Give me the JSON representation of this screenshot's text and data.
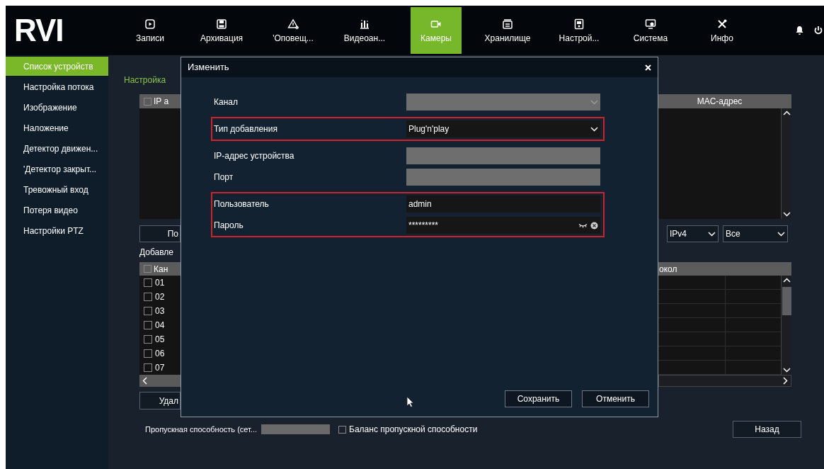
{
  "logo": "RVI",
  "nav": [
    {
      "label": "Записи",
      "selected": false
    },
    {
      "label": "Архивация",
      "selected": false
    },
    {
      "label": "'Оповещ...",
      "selected": false
    },
    {
      "label": "Видеоан...",
      "selected": false
    },
    {
      "label": "Камеры",
      "selected": true
    },
    {
      "label": "Хранилище",
      "selected": false
    },
    {
      "label": "Настрой...",
      "selected": false
    },
    {
      "label": "Система",
      "selected": false
    },
    {
      "label": "Инфо",
      "selected": false
    }
  ],
  "sidebar": {
    "items": [
      {
        "label": "Список устройств",
        "selected": true
      },
      {
        "label": "Настройка потока",
        "selected": false
      },
      {
        "label": "Изображение",
        "selected": false
      },
      {
        "label": "Наложение",
        "selected": false
      },
      {
        "label": "Детектор движен...",
        "selected": false
      },
      {
        "label": "'Детектор закрыт...",
        "selected": false
      },
      {
        "label": "Тревожный вход",
        "selected": false
      },
      {
        "label": "Потеря видео",
        "selected": false
      },
      {
        "label": "Настройки PTZ",
        "selected": false
      }
    ]
  },
  "background": {
    "tab": "Настройка",
    "search_table": {
      "columns": [
        "IP a",
        "MAC-адрес"
      ],
      "header_checked": false
    },
    "search_button": "По",
    "filters": [
      "IPv4",
      "Все"
    ],
    "added_label": "Добавле",
    "added_table": {
      "columns": [
        "Кан",
        "окол"
      ],
      "header_checked": false,
      "rows": [
        {
          "cell": "01",
          "checked": false
        },
        {
          "cell": "02",
          "checked": false
        },
        {
          "cell": "03",
          "checked": false
        },
        {
          "cell": "04",
          "checked": false
        },
        {
          "cell": "05",
          "checked": false
        },
        {
          "cell": "06",
          "checked": false
        },
        {
          "cell": "07",
          "checked": false
        }
      ]
    },
    "delete_button": "Удал",
    "bandwidth_label": "Пропускная способность (сет...",
    "balance": {
      "label": "Баланс пропускной способности",
      "checked": false
    },
    "back_button": "Назад"
  },
  "dialog": {
    "title": "Изменить",
    "groups": [
      {
        "highlighted": false,
        "fields": [
          {
            "label": "Канал",
            "kind": "select",
            "disabled": true
          }
        ]
      },
      {
        "highlighted": true,
        "fields": [
          {
            "label": "Тип добавления",
            "kind": "select",
            "disabled": false,
            "value": "Plug'n'play"
          }
        ]
      },
      {
        "highlighted": false,
        "fields": [
          {
            "label": "IP-адрес устройства",
            "kind": "input",
            "disabled": true
          },
          {
            "label": "Порт",
            "kind": "input",
            "disabled": true
          }
        ]
      },
      {
        "highlighted": true,
        "fields": [
          {
            "label": "Пользователь",
            "kind": "input",
            "disabled": false,
            "value": "admin"
          },
          {
            "label": "Пароль",
            "kind": "password",
            "disabled": false,
            "value": "*********"
          }
        ]
      }
    ],
    "buttons": [
      "Сохранить",
      "Отменить"
    ]
  }
}
